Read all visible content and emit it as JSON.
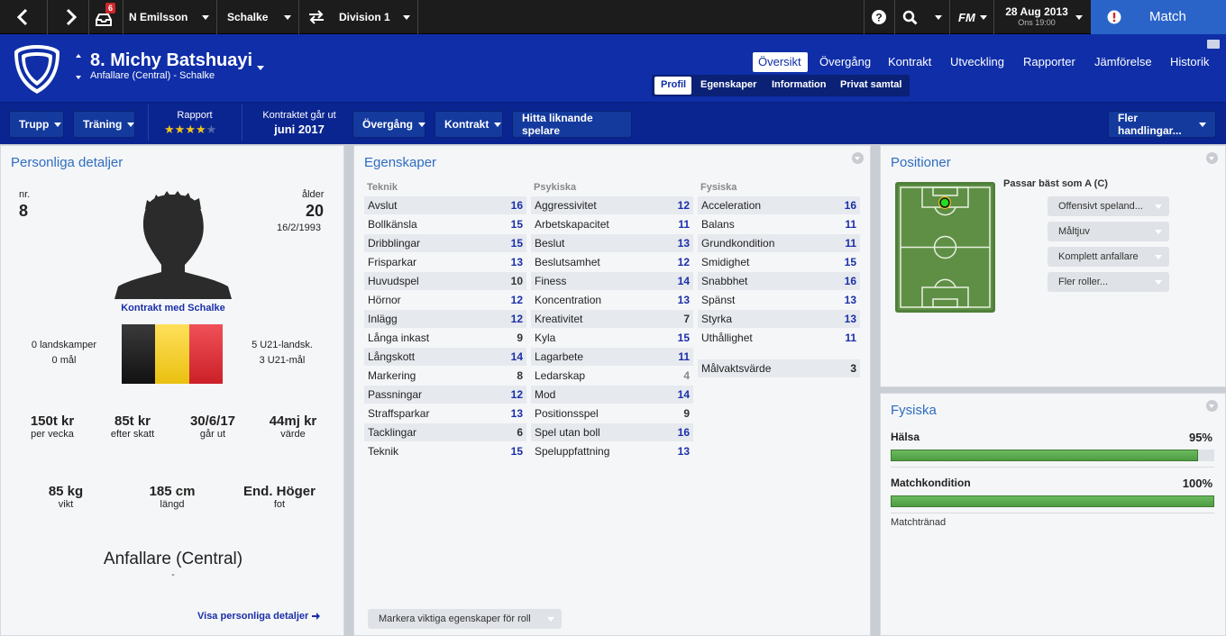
{
  "topbar": {
    "inbox_count": "6",
    "manager": "N Emilsson",
    "club": "Schalke",
    "league": "Division 1",
    "fm_label": "FM",
    "date": "28 Aug 2013",
    "time": "Ons 19:00",
    "match_label": "Match"
  },
  "player": {
    "title": "8. Michy Batshuayi",
    "subtitle": "Anfallare (Central) - Schalke"
  },
  "main_tabs": [
    "Översikt",
    "Övergång",
    "Kontrakt",
    "Utveckling",
    "Rapporter",
    "Jämförelse",
    "Historik"
  ],
  "sub_tabs": [
    "Profil",
    "Egenskaper",
    "Information",
    "Privat samtal"
  ],
  "actions": {
    "squad": "Trupp",
    "training": "Träning",
    "report_label": "Rapport",
    "report_stars": 4,
    "contract_expires_label": "Kontraktet går ut",
    "contract_expires_value": "juni 2017",
    "transfer": "Övergång",
    "contract": "Kontrakt",
    "similar": "Hitta liknande spelare",
    "more": "Fler handlingar..."
  },
  "personal": {
    "title": "Personliga detaljer",
    "nr_label": "nr.",
    "nr_value": "8",
    "age_label": "ålder",
    "age_value": "20",
    "dob": "16/2/1993",
    "contract_with": "Kontrakt med Schalke",
    "caps": "0 landskamper",
    "goals": "0 mål",
    "u21_caps": "5 U21-landsk.",
    "u21_goals": "3 U21-mål",
    "wage": "150t kr",
    "wage_label": "per vecka",
    "net": "85t kr",
    "net_label": "efter skatt",
    "expires": "30/6/17",
    "expires_label": "går ut",
    "value": "44mj kr",
    "value_label": "värde",
    "weight": "85 kg",
    "weight_label": "vikt",
    "height": "185 cm",
    "height_label": "längd",
    "foot": "End. Höger",
    "foot_label": "fot",
    "position": "Anfallare (Central)",
    "position_sub": "-",
    "link": "Visa personliga detaljer"
  },
  "attributes": {
    "title": "Egenskaper",
    "technical_label": "Teknik",
    "mental_label": "Psykiska",
    "physical_label": "Fysiska",
    "technical": [
      {
        "name": "Avslut",
        "value": "16"
      },
      {
        "name": "Bollkänsla",
        "value": "15"
      },
      {
        "name": "Dribblingar",
        "value": "15"
      },
      {
        "name": "Frisparkar",
        "value": "13"
      },
      {
        "name": "Huvudspel",
        "value": "10"
      },
      {
        "name": "Hörnor",
        "value": "12"
      },
      {
        "name": "Inlägg",
        "value": "12"
      },
      {
        "name": "Långa inkast",
        "value": "9"
      },
      {
        "name": "Långskott",
        "value": "14"
      },
      {
        "name": "Markering",
        "value": "8"
      },
      {
        "name": "Passningar",
        "value": "12"
      },
      {
        "name": "Straffsparkar",
        "value": "13"
      },
      {
        "name": "Tacklingar",
        "value": "6"
      },
      {
        "name": "Teknik",
        "value": "15"
      }
    ],
    "mental": [
      {
        "name": "Aggressivitet",
        "value": "12"
      },
      {
        "name": "Arbetskapacitet",
        "value": "11"
      },
      {
        "name": "Beslut",
        "value": "13"
      },
      {
        "name": "Beslutsamhet",
        "value": "12"
      },
      {
        "name": "Finess",
        "value": "14"
      },
      {
        "name": "Koncentration",
        "value": "13"
      },
      {
        "name": "Kreativitet",
        "value": "7"
      },
      {
        "name": "Kyla",
        "value": "15"
      },
      {
        "name": "Lagarbete",
        "value": "11"
      },
      {
        "name": "Ledarskap",
        "value": "4"
      },
      {
        "name": "Mod",
        "value": "14"
      },
      {
        "name": "Positionsspel",
        "value": "9"
      },
      {
        "name": "Spel utan boll",
        "value": "16"
      },
      {
        "name": "Speluppfattning",
        "value": "13"
      }
    ],
    "physical": [
      {
        "name": "Acceleration",
        "value": "16"
      },
      {
        "name": "Balans",
        "value": "11"
      },
      {
        "name": "Grundkondition",
        "value": "11"
      },
      {
        "name": "Smidighet",
        "value": "15"
      },
      {
        "name": "Snabbhet",
        "value": "16"
      },
      {
        "name": "Spänst",
        "value": "13"
      },
      {
        "name": "Styrka",
        "value": "13"
      },
      {
        "name": "Uthållighet",
        "value": "11"
      }
    ],
    "gk_label": "Målvaktsvärde",
    "gk_value": "3",
    "highlight_btn": "Markera viktiga egenskaper för roll"
  },
  "positions": {
    "title": "Positioner",
    "best_label": "Passar bäst som A (C)",
    "roles": [
      "Offensivt speland...",
      "Måltjuv",
      "Komplett anfallare",
      "Fler roller..."
    ]
  },
  "physical_panel": {
    "title": "Fysiska",
    "health_label": "Hälsa",
    "health_value": "95%",
    "health_fill": 0.95,
    "condition_label": "Matchkondition",
    "condition_value": "100%",
    "condition_fill": 1.0,
    "sharpness": "Matchtränad"
  },
  "colors": {
    "header_blue": "#0f2ea8",
    "match_blue": "#2a64c8",
    "attr_high": "#1a2fa8",
    "bar_green": "#5aa84e",
    "flag_black": "#222222",
    "flag_yellow": "#f5d023",
    "flag_red": "#e3323a"
  }
}
